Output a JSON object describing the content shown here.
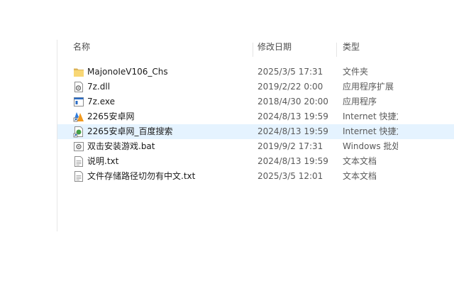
{
  "header": {
    "name": "名称",
    "date": "修改日期",
    "type": "类型"
  },
  "files": [
    {
      "name": "MajonoIeV106_Chs",
      "date": "2025/3/5 17:31",
      "type": "文件夹",
      "icon": "folder-icon"
    },
    {
      "name": "7z.dll",
      "date": "2019/2/22 0:00",
      "type": "应用程序扩展",
      "icon": "dll-file-icon"
    },
    {
      "name": "7z.exe",
      "date": "2018/4/30 20:00",
      "type": "应用程序",
      "icon": "exe-file-icon"
    },
    {
      "name": "2265安卓网",
      "date": "2024/8/13 19:59",
      "type": "Internet 快捷方式",
      "icon": "internet-shortcut-icon"
    },
    {
      "name": "2265安卓网_百度搜索",
      "date": "2024/8/13 19:59",
      "type": "Internet 快捷方式",
      "icon": "web-shortcut-icon"
    },
    {
      "name": "双击安装游戏.bat",
      "date": "2019/9/2 17:31",
      "type": "Windows 批处理文件",
      "icon": "bat-file-icon"
    },
    {
      "name": "说明.txt",
      "date": "2024/8/13 19:59",
      "type": "文本文档",
      "icon": "text-file-icon"
    },
    {
      "name": "文件存储路径切勿有中文.txt",
      "date": "2025/3/5 12:01",
      "type": "文本文档",
      "icon": "text-file-icon"
    }
  ],
  "colors": {
    "hover_row": "#e5f3ff",
    "folder": "#f8d775",
    "text": "#1a1a1a",
    "secondary_text": "#595959"
  }
}
